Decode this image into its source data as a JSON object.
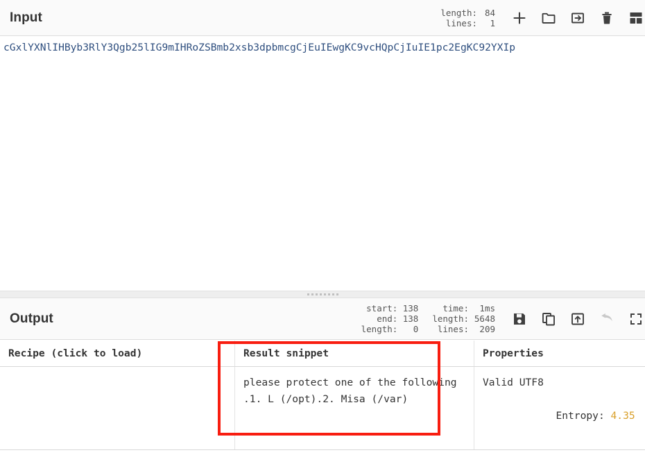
{
  "input_panel": {
    "title": "Input",
    "stats": [
      {
        "key": "length:",
        "value": "84"
      },
      {
        "key": "lines:",
        "value": "1"
      }
    ],
    "text": "cGxlYXNlIHByb3RlY3Qgb25lIG9mIHRoZSBmb2xsb3dpbmcgCjEuIEwgKC9vcHQpCjIuIE1pc2EgKC92YXIp",
    "placeholder": "Input",
    "toolbar": [
      {
        "icon": "plus-icon",
        "label": "Add a new input tab"
      },
      {
        "icon": "folder-icon",
        "label": "Open file as input"
      },
      {
        "icon": "open-folder-icon",
        "label": "Open folder as input"
      },
      {
        "icon": "trash-icon",
        "label": "Clear input and output"
      },
      {
        "icon": "grid-icon",
        "label": "Tile input tabs"
      }
    ]
  },
  "output_panel": {
    "title": "Output",
    "stats_left": [
      {
        "key": "start:",
        "value": "138"
      },
      {
        "key": "end:",
        "value": "138"
      },
      {
        "key": "length:",
        "value": "0"
      }
    ],
    "stats_right": [
      {
        "key": "time:",
        "value": "1ms"
      },
      {
        "key": "length:",
        "value": "5648"
      },
      {
        "key": "lines:",
        "value": "209"
      }
    ],
    "toolbar": [
      {
        "icon": "save-icon",
        "label": "Save output to file"
      },
      {
        "icon": "copy-icon",
        "label": "Copy raw output to the clipboard"
      },
      {
        "icon": "replace-input-icon",
        "label": "Replace input with output"
      },
      {
        "icon": "undo-icon",
        "label": "Step back through the recipe",
        "disabled": true
      },
      {
        "icon": "maximize-icon",
        "label": "Maximise output pane"
      }
    ]
  },
  "results_table": {
    "headers": [
      "Recipe (click to load)",
      "Result snippet",
      "Properties"
    ],
    "rows": [
      {
        "recipe": "",
        "snippet": "please protect one of the following .1. L (/opt).2. Misa (/var)",
        "properties": {
          "validity": "Valid UTF8",
          "entropy_label": "Entropy: ",
          "entropy_value": "4.35"
        }
      }
    ]
  },
  "colors": {
    "highlight": "#f81d10",
    "input_text": "#2f4f7f",
    "entropy": "#d9a02a",
    "header_bg": "#fafafa"
  }
}
